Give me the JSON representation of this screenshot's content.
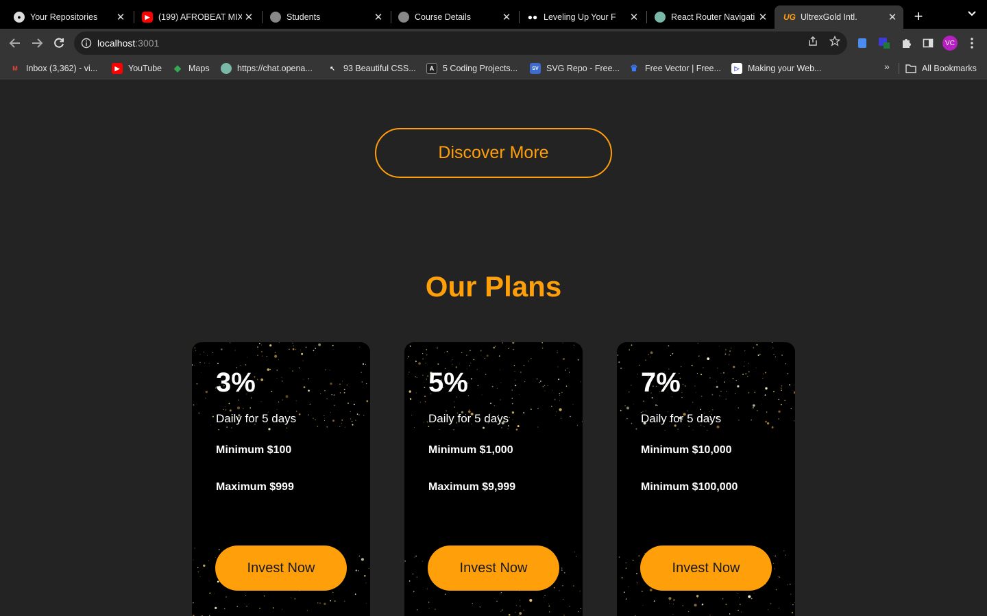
{
  "browser": {
    "tabs": [
      {
        "title": "Your Repositories",
        "icon": "github-icon"
      },
      {
        "title": "(199) AFROBEAT MIX",
        "icon": "youtube-icon"
      },
      {
        "title": "Students",
        "icon": "globe-icon"
      },
      {
        "title": "Course Details",
        "icon": "globe-icon"
      },
      {
        "title": "Leveling Up Your F",
        "icon": "medium-icon"
      },
      {
        "title": "React Router Navigati",
        "icon": "chatgpt-icon"
      },
      {
        "title": "UltrexGold Intl.",
        "icon": "ug-logo-icon"
      }
    ],
    "address": {
      "host": "localhost",
      "port": ":3001"
    },
    "profile_initials": "VC",
    "bookmarks": [
      {
        "label": "Inbox (3,362) - vi...",
        "icon": "gmail-icon"
      },
      {
        "label": "YouTube",
        "icon": "youtube-icon"
      },
      {
        "label": "Maps",
        "icon": "maps-icon"
      },
      {
        "label": "https://chat.opena...",
        "icon": "chatgpt-icon"
      },
      {
        "label": "93 Beautiful CSS...",
        "icon": "cursor-icon"
      },
      {
        "label": "5 Coding Projects...",
        "icon": "angular-icon"
      },
      {
        "label": "SVG Repo - Free...",
        "icon": "svgrepo-icon"
      },
      {
        "label": "Free Vector | Free...",
        "icon": "freepik-icon"
      },
      {
        "label": "Making your Web...",
        "icon": "play-icon"
      }
    ],
    "more_bookmarks": "»",
    "all_bookmarks": "All Bookmarks"
  },
  "page": {
    "discover_label": "Discover More",
    "plans_title": "Our Plans",
    "plans": [
      {
        "percent": "3%",
        "duration": "Daily for 5 days",
        "min": "Minimum $100",
        "max": "Maximum $999",
        "cta": "Invest Now"
      },
      {
        "percent": "5%",
        "duration": "Daily for 5 days",
        "min": "Minimum $1,000",
        "max": "Maximum $9,999",
        "cta": "Invest Now"
      },
      {
        "percent": "7%",
        "duration": "Daily for 5 days",
        "min": "Minimum $10,000",
        "max": "Minimum $100,000",
        "cta": "Invest Now"
      }
    ]
  },
  "colors": {
    "accent": "#ff9f0a",
    "page_bg": "#232323",
    "card_bg": "#000000"
  }
}
